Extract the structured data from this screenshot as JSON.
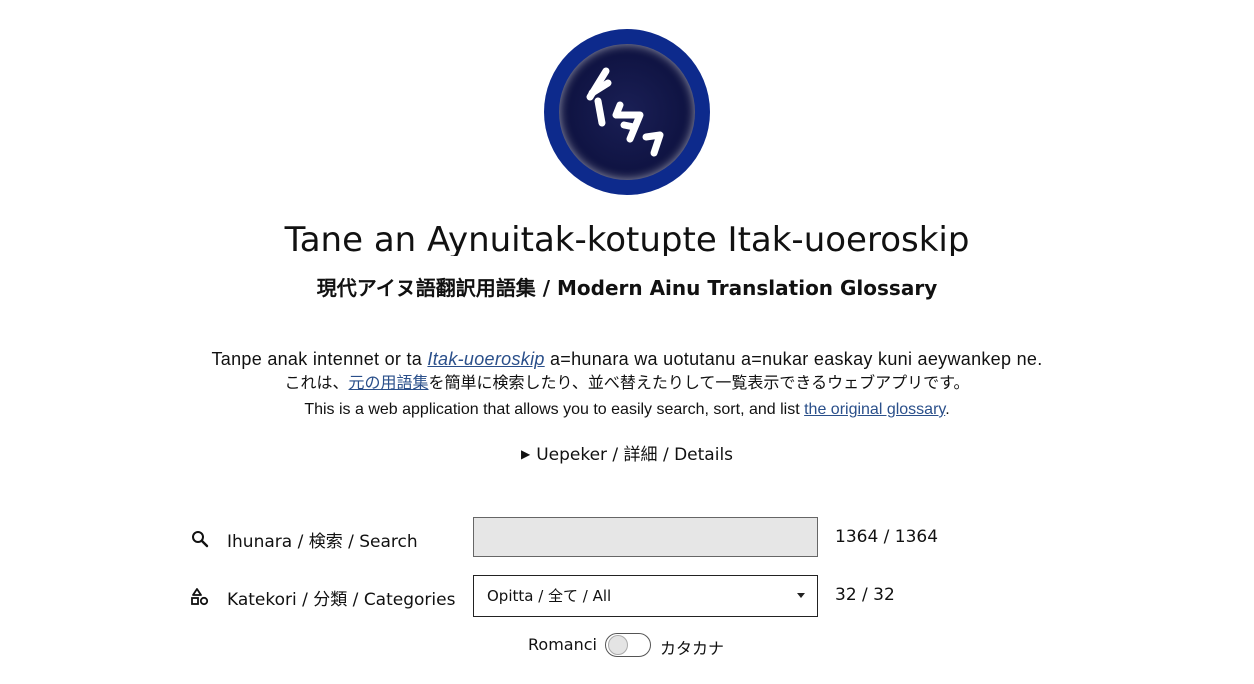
{
  "header": {
    "title": "Tane an Aynuitak-kotupte Itak-uoeroskip",
    "subtitle": "現代アイヌ語翻訳用語集 / Modern Ainu Translation Glossary",
    "logo_text": "イタㇰ"
  },
  "intro": {
    "line1_before": "Tanpe anak intennet or ta ",
    "line1_link": "Itak-uoeroskip",
    "line1_after": " a=hunara wa uotutanu a=nukar easkay kuni aeywankep ne.",
    "line2_before": "これは、",
    "line2_link": "元の用語集",
    "line2_after": "を簡単に検索したり、並べ替えたりして一覧表示できるウェブアプリです。",
    "line3_before": "This is a web application that allows you to easily search, sort, and list ",
    "line3_link": "the original glossary",
    "line3_after": "."
  },
  "details": {
    "label": "Uepeker / 詳細 / Details"
  },
  "search": {
    "label": "Ihunara / 検索 / Search",
    "value": "",
    "count": "1364 / 1364"
  },
  "category": {
    "label": "Katekori / 分類 / Categories",
    "selected": "Opitta / 全て / All",
    "count": "32 / 32"
  },
  "script_toggle": {
    "left_label": "Romanci",
    "right_label": "カタカナ",
    "checked": false
  },
  "colors": {
    "link": "#2a4f8a",
    "logo_ring": "#0d2a8c",
    "search_bg": "#e6e6e6"
  }
}
